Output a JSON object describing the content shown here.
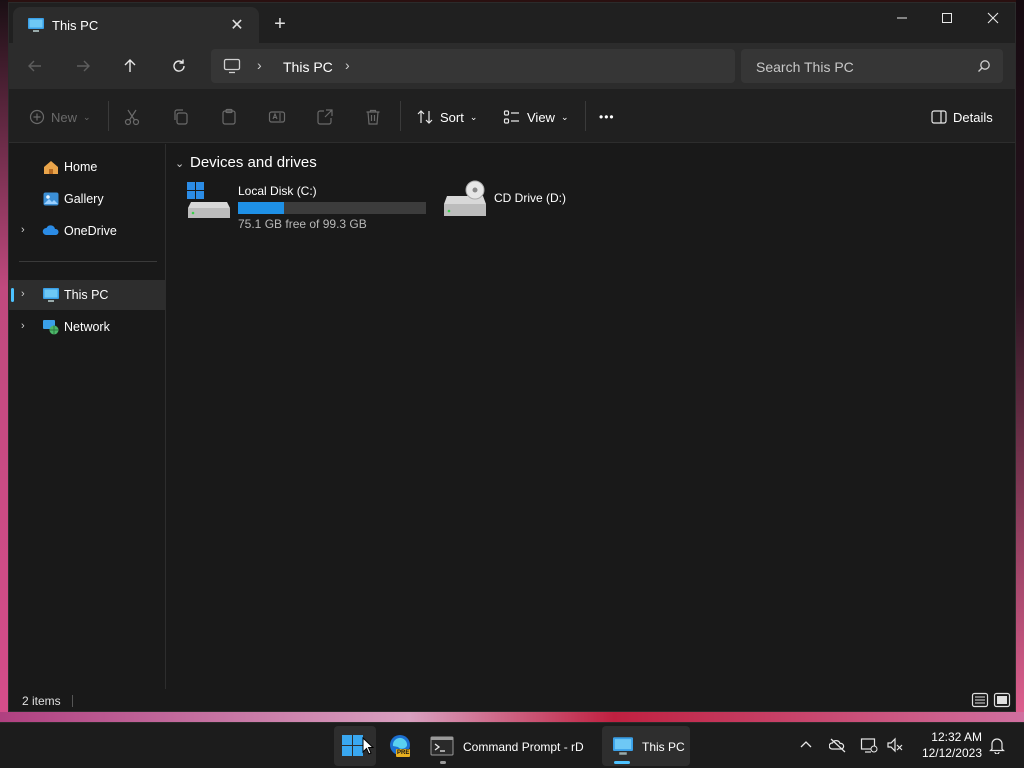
{
  "window": {
    "tab_title": "This PC",
    "new_tab_symbol": "+",
    "close_tab_symbol": "✕"
  },
  "address": {
    "location": "This PC",
    "search_placeholder": "Search This PC"
  },
  "command_bar": {
    "new_label": "New",
    "sort_label": "Sort",
    "view_label": "View",
    "more_label": "•••",
    "details_label": "Details"
  },
  "sidebar": {
    "items": [
      {
        "label": "Home",
        "icon": "home-icon"
      },
      {
        "label": "Gallery",
        "icon": "gallery-icon"
      },
      {
        "label": "OneDrive",
        "icon": "onedrive-icon"
      },
      {
        "label": "This PC",
        "icon": "this-pc-icon"
      },
      {
        "label": "Network",
        "icon": "network-icon"
      }
    ]
  },
  "content": {
    "group_title": "Devices and drives",
    "drives": [
      {
        "name": "Local Disk (C:)",
        "free_text": "75.1 GB free of 99.3 GB",
        "used_fraction": 0.244
      },
      {
        "name": "CD Drive (D:)"
      }
    ]
  },
  "status": {
    "item_count": "2 items"
  },
  "taskbar": {
    "items": [
      {
        "label": "Command Prompt - rD",
        "icon": "command-prompt-icon"
      },
      {
        "label": "This PC",
        "icon": "this-pc-icon"
      }
    ],
    "edge_badge": "PRE",
    "time": "12:32 AM",
    "date": "12/12/2023"
  },
  "colors": {
    "accent": "#4cc2ff",
    "drive_fill": "#1e90e6",
    "window_bg": "#191919"
  }
}
